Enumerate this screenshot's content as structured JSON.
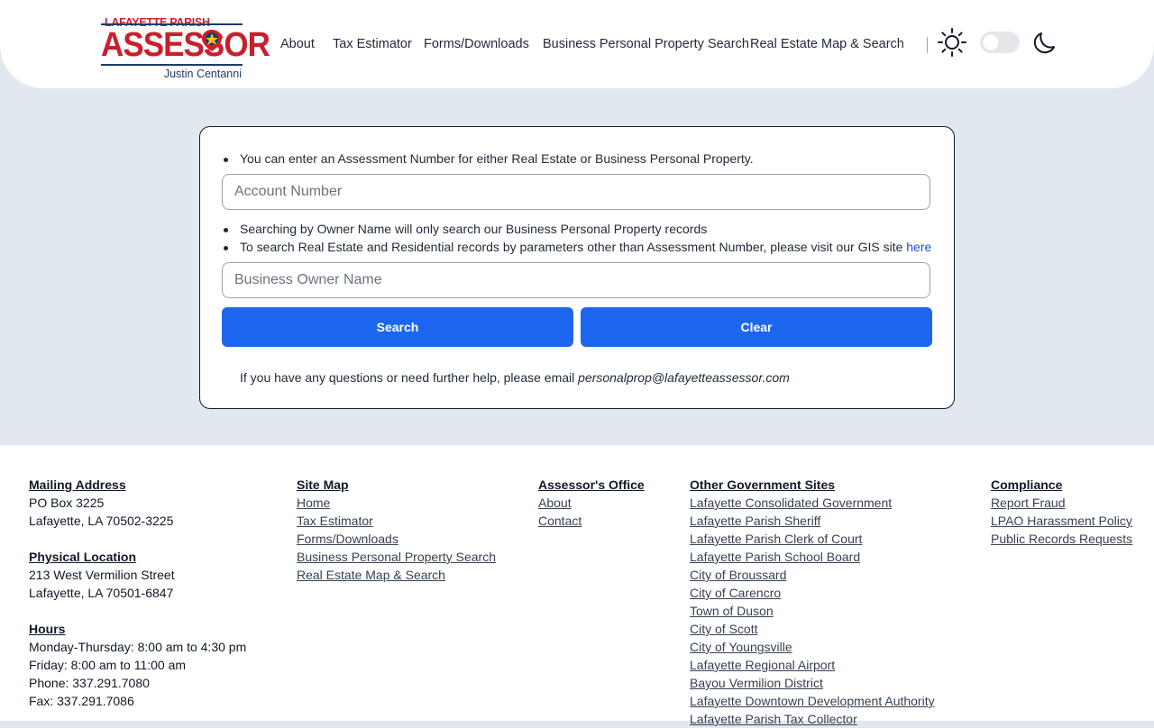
{
  "logo": {
    "line1": "LAFAYETTE PARISH",
    "line2": "ASSESSOR",
    "line3": "Justin Centanni"
  },
  "nav": [
    {
      "label": "About"
    },
    {
      "label": "Tax Estimator"
    },
    {
      "label": "Forms/Downloads"
    },
    {
      "label": "Business Personal Property Search"
    },
    {
      "label": "Real Estate Map & Search"
    }
  ],
  "search": {
    "bullet1": "You can enter an Assessment Number for either Real Estate or Business Personal Property.",
    "account_placeholder": "Account Number",
    "bullet2": "Searching by Owner Name will only search our Business Personal Property records",
    "bullet3": "To search Real Estate and Residential records by parameters other than Assessment Number, please visit our GIS site",
    "bullet3_link": "here",
    "owner_placeholder": "Business Owner Name",
    "search_label": "Search",
    "clear_label": "Clear",
    "help_text": "If you have any questions or need further help, please email",
    "help_email": "personalprop@lafayetteassessor.com"
  },
  "footer": {
    "mailing": {
      "heading": "Mailing Address",
      "lines": [
        "PO Box 3225",
        "Lafayette, LA 70502-3225"
      ]
    },
    "physical": {
      "heading": "Physical Location",
      "lines": [
        "213 West Vermilion Street",
        "Lafayette, LA 70501-6847"
      ]
    },
    "hours": {
      "heading": "Hours",
      "lines": [
        "Monday-Thursday: 8:00 am to 4:30 pm",
        "Friday: 8:00 am to 11:00 am",
        "Phone: 337.291.7080",
        "Fax: 337.291.7086"
      ]
    },
    "sitemap": {
      "heading": "Site Map",
      "links": [
        "Home",
        "Tax Estimator",
        "Forms/Downloads",
        "Business Personal Property Search",
        "Real Estate Map & Search"
      ]
    },
    "office": {
      "heading": "Assessor's Office",
      "links": [
        "About",
        "Contact"
      ]
    },
    "gov": {
      "heading": "Other Government Sites",
      "links": [
        "Lafayette Consolidated Government",
        "Lafayette Parish Sheriff",
        "Lafayette Parish Clerk of Court",
        "Lafayette Parish School Board",
        "City of Broussard",
        "City of Carencro",
        "Town of Duson",
        "City of Scott",
        "City of Youngsville",
        "Lafayette Regional Airport",
        "Bayou Vermilion District",
        "Lafayette Downtown Development Authority",
        "Lafayette Parish Tax Collector"
      ]
    },
    "compliance": {
      "heading": "Compliance",
      "links": [
        "Report Fraud",
        "LPAO Harassment Policy",
        "Public Records Requests"
      ]
    }
  },
  "colors": {
    "accent": "#1d66f0",
    "brand_red": "#c8202c",
    "brand_navy": "#1e3a6e",
    "page_bg": "#e2e8f0"
  }
}
